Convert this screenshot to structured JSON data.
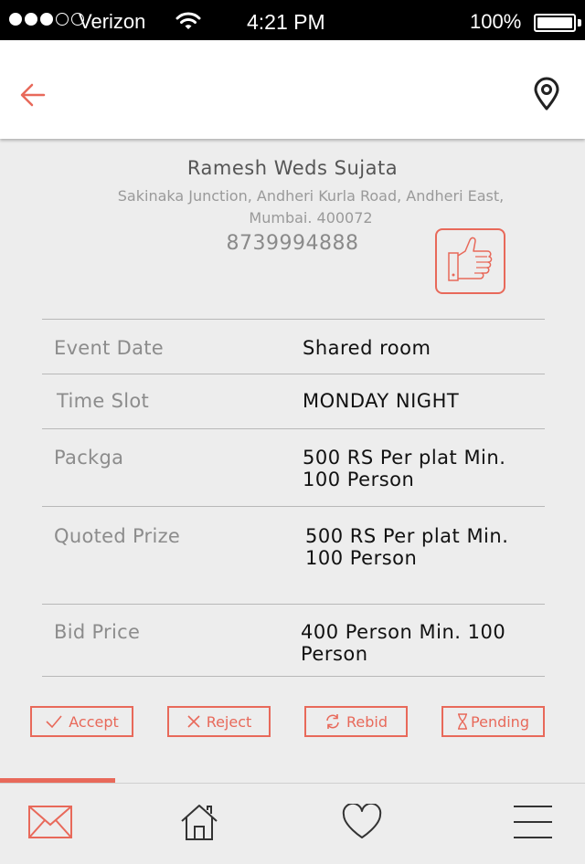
{
  "status_bar": {
    "carrier": "Verizon",
    "time": "4:21 PM",
    "battery": "100%"
  },
  "header": {
    "back_icon": "arrow-left-icon",
    "location_icon": "location-pin-icon"
  },
  "venue": {
    "name": "Ramesh Weds Sujata",
    "address": "Sakinaka Junction, Andheri Kurla Road, Andheri East, Mumbai. 400072",
    "phone": "8739994888",
    "like_icon": "thumbs-up-icon"
  },
  "details": [
    {
      "label": "Event Date",
      "value": "Shared room"
    },
    {
      "label": "Time Slot",
      "value": "MONDAY  NIGHT"
    },
    {
      "label": "Packga",
      "value": "500 RS Per plat Min. 100 Person"
    },
    {
      "label": "Quoted Prize",
      "value": "500 RS Per plat Min. 100 Person"
    },
    {
      "label": "Bid Price",
      "value": "400 Person Min. 100 Person"
    }
  ],
  "actions": {
    "accept": "Accept",
    "reject": "Reject",
    "rebid": "Rebid",
    "pending": "Pending"
  },
  "tabs": [
    "mail-icon",
    "home-icon",
    "heart-icon",
    "menu-icon"
  ],
  "colors": {
    "accent": "#e8695a",
    "background": "#ededed",
    "header": "#ffffff"
  }
}
